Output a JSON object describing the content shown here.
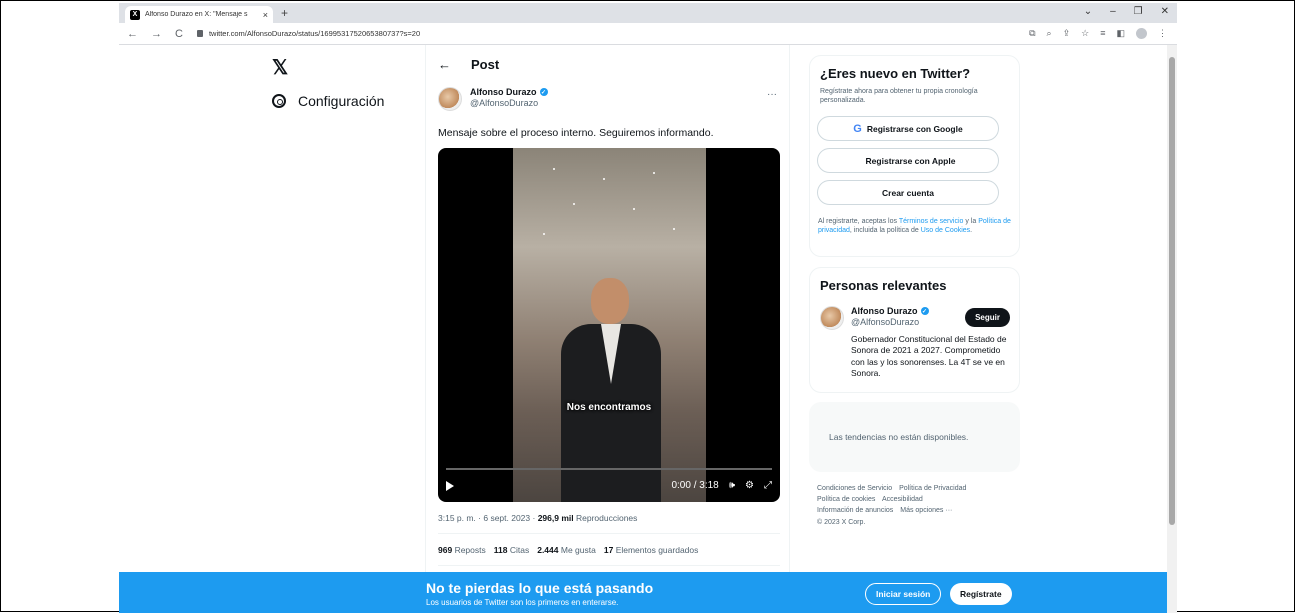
{
  "browser": {
    "tab_title": "Alfonso Durazo en X: \"Mensaje s",
    "tab_close": "×",
    "new_tab": "+",
    "url": "twitter.com/AlfonsoDurazo/status/1699531752065380737?s=20",
    "window_controls": [
      "⌄",
      "–",
      "❐",
      "✕"
    ]
  },
  "sidebar": {
    "logo": "𝕏",
    "settings_label": "Configuración"
  },
  "post": {
    "header": "Post",
    "back": "←",
    "author_name": "Alfonso Durazo",
    "author_handle": "@AlfonsoDurazo",
    "more": "···",
    "text": "Mensaje sobre el proceso interno. Seguiremos informando.",
    "video_subtitle": "Nos encontramos",
    "video_time": "0:00 / 3:18",
    "timestamp": "3:15 p. m. · 6 sept. 2023 · ",
    "views_count": "296,9 mil",
    "views_label": " Reproducciones",
    "reposts_count": "969",
    "reposts_label": "Reposts",
    "quotes_count": "118",
    "quotes_label": "Citas",
    "likes_count": "2.444",
    "likes_label": "Me gusta",
    "bookmarks_count": "17",
    "bookmarks_label": "Elementos guardados"
  },
  "signup": {
    "title": "¿Eres nuevo en Twitter?",
    "subtitle": "Regístrate ahora para obtener tu propia cronología personalizada.",
    "google_label": "Registrarse con Google",
    "apple_label": "Registrarse con Apple",
    "create_label": "Crear cuenta",
    "legal_1": "Al registrarte, aceptas los ",
    "terms_link": "Términos de servicio",
    "legal_2": " y la ",
    "privacy_link": "Política de privacidad",
    "legal_3": ", incluida la política de ",
    "cookies_link": "Uso de Cookies",
    "legal_4": "."
  },
  "relevant": {
    "title": "Personas relevantes",
    "name": "Alfonso Durazo",
    "handle": "@AlfonsoDurazo",
    "bio": "Gobernador Constitucional del Estado de Sonora de 2021 a 2027. Comprometido con las y los sonorenses. La 4T se ve en Sonora.",
    "follow_label": "Seguir"
  },
  "trends": {
    "message": "Las tendencias no están disponibles."
  },
  "footer": {
    "links": [
      "Condiciones de Servicio",
      "Política de Privacidad",
      "Política de cookies",
      "Accesibilidad",
      "Información de anuncios",
      "Más opciones ···"
    ],
    "copyright": "© 2023 X Corp."
  },
  "banner": {
    "title": "No te pierdas lo que está pasando",
    "subtitle": "Los usuarios de Twitter son los primeros en enterarse.",
    "login_label": "Iniciar sesión",
    "register_label": "Regístrate"
  },
  "colors": {
    "accent": "#1d9bf0",
    "text": "#0f1419",
    "muted": "#536471"
  }
}
